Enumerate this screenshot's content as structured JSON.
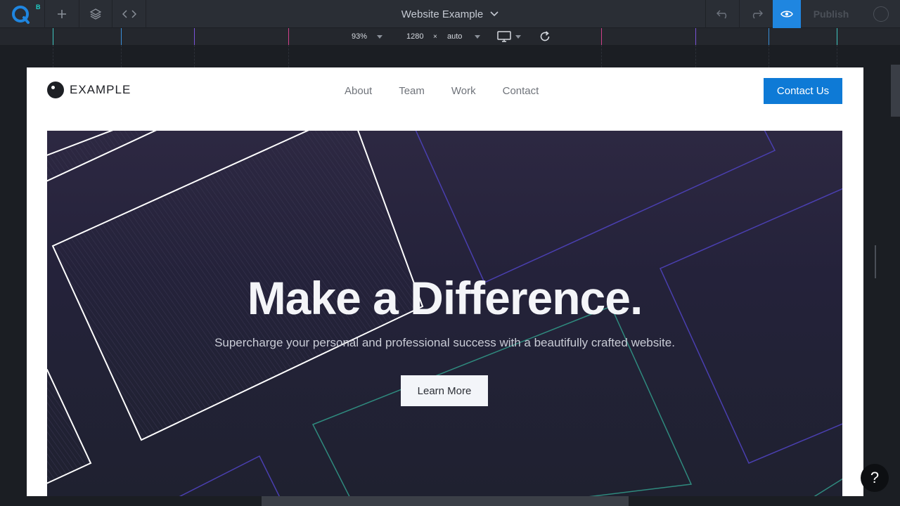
{
  "app": {
    "logo_superscript": "B",
    "site_title": "Website Example",
    "publish_label": "Publish",
    "icons": {
      "add": "plus-icon",
      "layers": "layers-icon",
      "code": "code-icon",
      "undo": "undo-icon",
      "redo": "redo-icon",
      "preview": "eye-icon",
      "account": "account-icon",
      "help": "help-icon"
    },
    "accent_color": "#1f86e0"
  },
  "viewport_bar": {
    "zoom": "93%",
    "width": "1280",
    "times": "×",
    "height": "auto",
    "device": "desktop-icon",
    "refresh": "refresh-icon"
  },
  "site": {
    "logo_text": "EXAMPLE",
    "nav": [
      "About",
      "Team",
      "Work",
      "Contact"
    ],
    "cta_label": "Contact Us",
    "cta_color": "#0e7ad6",
    "hero": {
      "title": "Make a Difference.",
      "subtitle": "Supercharge your personal and professional success with a beautifully crafted website.",
      "button_label": "Learn More"
    }
  },
  "help_label": "?"
}
